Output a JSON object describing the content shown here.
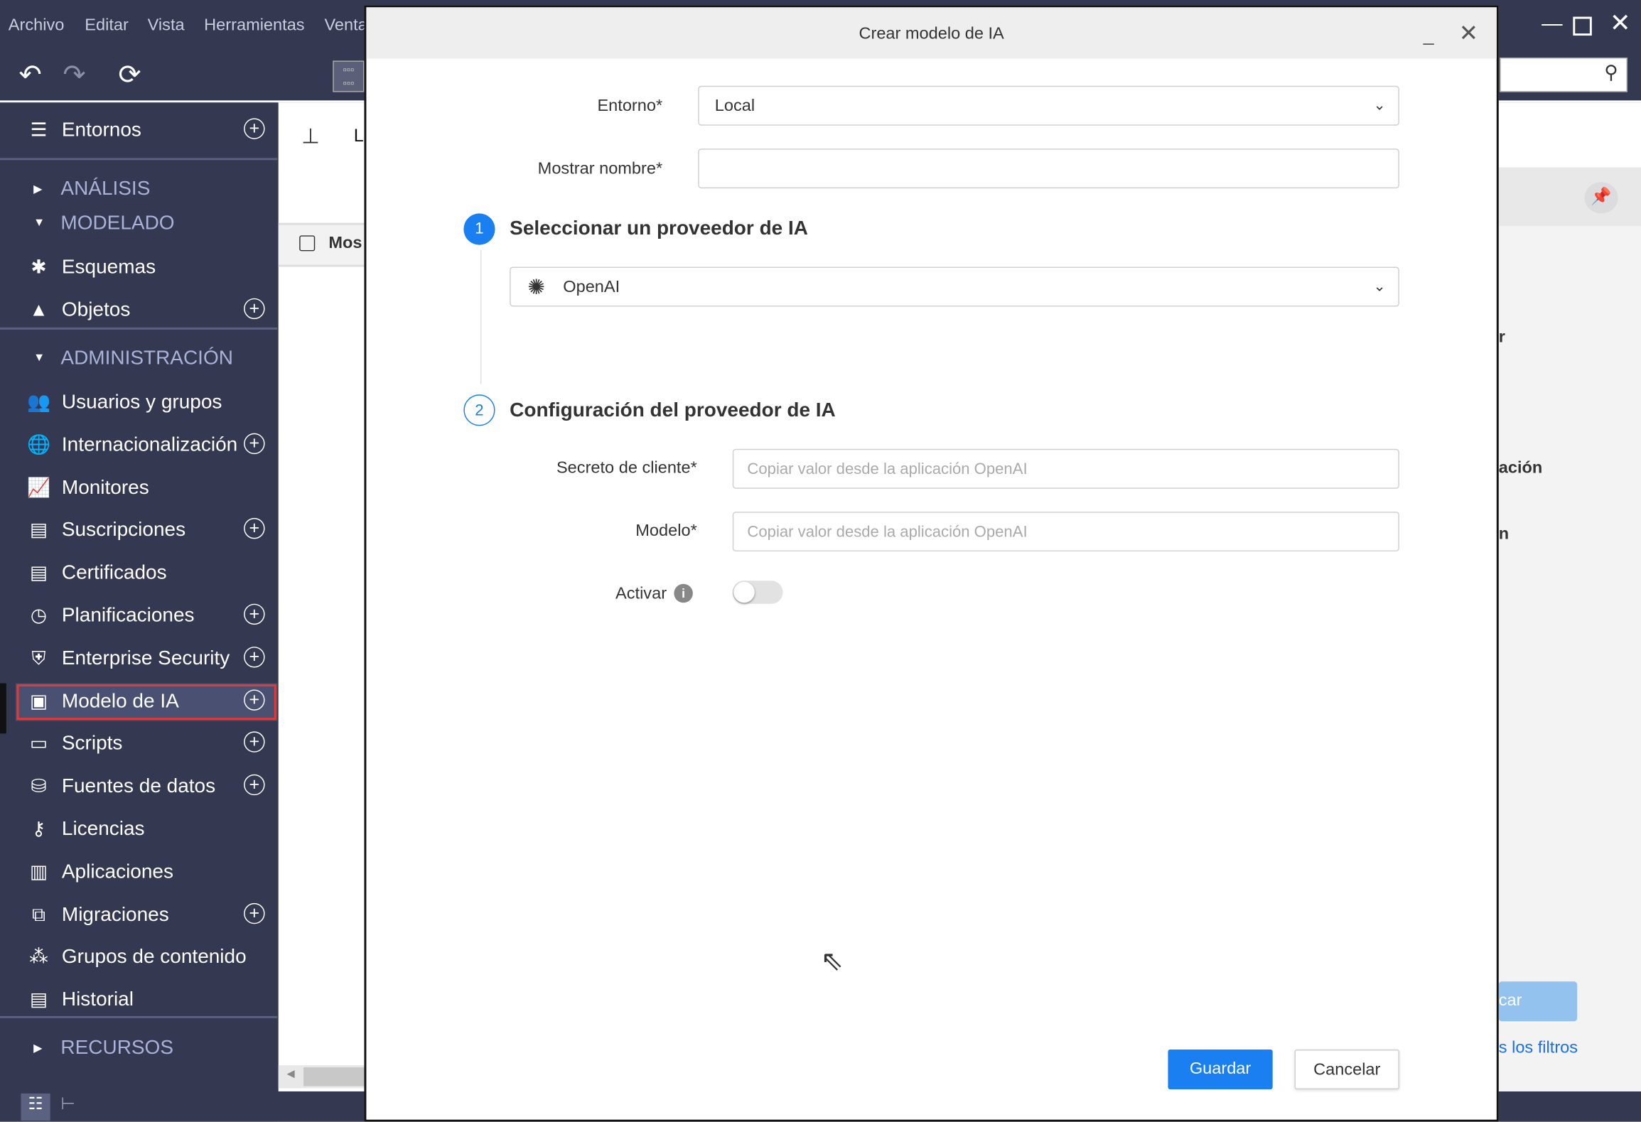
{
  "menubar": {
    "items": [
      "Archivo",
      "Editar",
      "Vista",
      "Herramientas",
      "Ventana"
    ]
  },
  "window_controls": {
    "minimize": "minimize-icon",
    "maximize": "maximize-icon",
    "close": "close-icon"
  },
  "sidebar": {
    "top_item": {
      "label": "Entornos",
      "icon": "server-icon"
    },
    "sections": [
      {
        "label": "ANÁLISIS",
        "expanded": false
      },
      {
        "label": "MODELADO",
        "expanded": true
      },
      {
        "label": "ADMINISTRACIÓN",
        "expanded": true
      },
      {
        "label": "RECURSOS",
        "expanded": false
      }
    ],
    "modelado_items": [
      {
        "label": "Esquemas",
        "add": false
      },
      {
        "label": "Objetos",
        "add": true
      }
    ],
    "admin_items": [
      {
        "label": "Usuarios y grupos",
        "add": false
      },
      {
        "label": "Internacionalización",
        "add": true
      },
      {
        "label": "Monitores",
        "add": false
      },
      {
        "label": "Suscripciones",
        "add": true
      },
      {
        "label": "Certificados",
        "add": false
      },
      {
        "label": "Planificaciones",
        "add": true
      },
      {
        "label": "Enterprise Security",
        "add": true
      },
      {
        "label": "Modelo de IA",
        "add": true,
        "selected": true
      },
      {
        "label": "Scripts",
        "add": true
      },
      {
        "label": "Fuentes de datos",
        "add": true
      },
      {
        "label": "Licencias",
        "add": false
      },
      {
        "label": "Aplicaciones",
        "add": false
      },
      {
        "label": "Migraciones",
        "add": true
      },
      {
        "label": "Grupos de contenido",
        "add": false
      },
      {
        "label": "Historial",
        "add": false
      }
    ],
    "highlight_color": "#e53935"
  },
  "background": {
    "header_partial": "L",
    "column_partial": "Mos",
    "text_r": "r",
    "text_acion": "ación",
    "text_n": "n",
    "button_partial": "car",
    "link_partial": "s los filtros"
  },
  "dialog": {
    "title": "Crear modelo de IA",
    "entorno_label": "Entorno*",
    "entorno_value": "Local",
    "nombre_label": "Mostrar nombre*",
    "nombre_value": "",
    "step1": {
      "number": "1",
      "title": "Seleccionar un proveedor de IA",
      "provider": "OpenAI"
    },
    "step2": {
      "number": "2",
      "title": "Configuración del proveedor de IA"
    },
    "secreto_label": "Secreto de cliente*",
    "secreto_placeholder": "Copiar valor desde la aplicación OpenAI",
    "modelo_label": "Modelo*",
    "modelo_placeholder": "Copiar valor desde la aplicación OpenAI",
    "activar_label": "Activar",
    "activar_on": false,
    "save": "Guardar",
    "cancel": "Cancelar",
    "accent": "#1a7ff0"
  }
}
